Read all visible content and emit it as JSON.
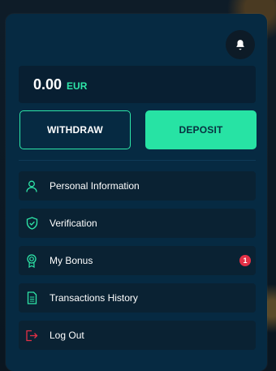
{
  "balance": {
    "amount": "0.00",
    "currency": "EUR"
  },
  "actions": {
    "withdraw_label": "WITHDRAW",
    "deposit_label": "DEPOSIT"
  },
  "menu": {
    "items": [
      {
        "label": "Personal Information",
        "icon": "user-icon"
      },
      {
        "label": "Verification",
        "icon": "shield-check-icon"
      },
      {
        "label": "My Bonus",
        "icon": "award-icon",
        "badge": "1"
      },
      {
        "label": "Transactions History",
        "icon": "document-icon"
      },
      {
        "label": "Log Out",
        "icon": "logout-icon"
      }
    ]
  },
  "colors": {
    "accent": "#2ee6a8",
    "panel": "#062a42",
    "badge": "#e33046",
    "logout_icon": "#e33046"
  }
}
